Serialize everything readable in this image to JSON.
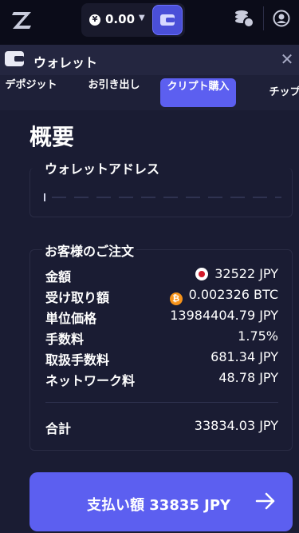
{
  "topbar": {
    "currency_symbol": "¥",
    "balance": "0.00",
    "icons": [
      "logo-icon",
      "coin-icon",
      "chevron-down-icon",
      "wallet-icon",
      "coins-icon",
      "user-icon"
    ]
  },
  "panel": {
    "title": "ウォレット"
  },
  "tabs": [
    {
      "label": "デポジット",
      "active": false
    },
    {
      "label": "お引き出し",
      "active": false
    },
    {
      "label": "クリプト購入",
      "active": true
    },
    {
      "label": "チップ",
      "active": false
    }
  ],
  "overview": {
    "title": "概要",
    "wallet_address_label": "ウォレットアドレス",
    "wallet_address_value": ""
  },
  "order": {
    "title": "お客様のご注文",
    "rows": [
      {
        "label": "金額",
        "value": "32522 JPY",
        "icon": "jpy-flag-icon"
      },
      {
        "label": "受け取り額",
        "value": "0.002326 BTC",
        "icon": "bitcoin-icon"
      },
      {
        "label": "単位価格",
        "value": "13984404.79 JPY"
      },
      {
        "label": "手数料",
        "value": "1.75%"
      },
      {
        "label": "取扱手数料",
        "value": "681.34 JPY"
      },
      {
        "label": "ネットワーク料",
        "value": "48.78 JPY"
      }
    ],
    "total_label": "合計",
    "total_value": "33834.03 JPY"
  },
  "pay_button": {
    "label": "支払い額 33835 JPY"
  },
  "colors": {
    "accent": "#5c5ff0",
    "background": "#1a1c33",
    "topbar": "#0b0c19",
    "bitcoin": "#f7931a",
    "jpy_red": "#d11a2a"
  }
}
